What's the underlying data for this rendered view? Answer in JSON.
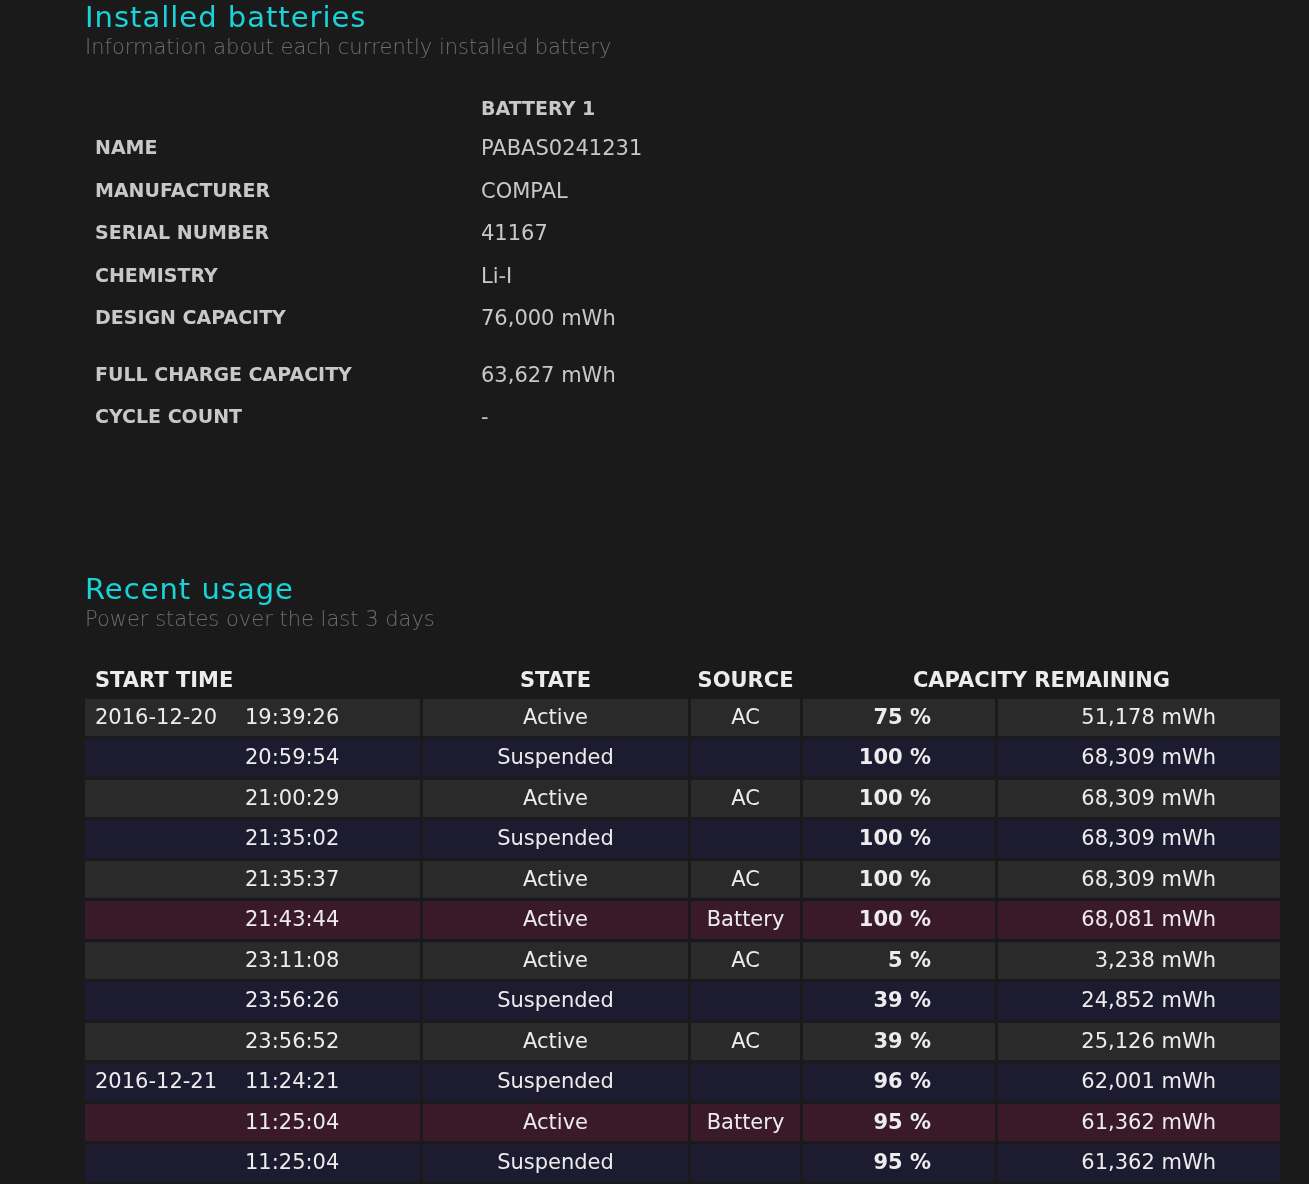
{
  "installed": {
    "title": "Installed batteries",
    "subtitle": "Information about each currently installed battery",
    "column_header": "BATTERY 1",
    "fields": [
      {
        "label": "NAME",
        "value": "PABAS0241231"
      },
      {
        "label": "MANUFACTURER",
        "value": "COMPAL"
      },
      {
        "label": "SERIAL NUMBER",
        "value": "41167"
      },
      {
        "label": "CHEMISTRY",
        "value": "Li-I"
      },
      {
        "label": "DESIGN CAPACITY",
        "value": "76,000 mWh"
      },
      {
        "label": "FULL CHARGE CAPACITY",
        "value": "63,627 mWh"
      },
      {
        "label": "CYCLE COUNT",
        "value": "-"
      }
    ]
  },
  "recent_usage": {
    "title": "Recent usage",
    "subtitle": "Power states over the last 3 days",
    "columns": [
      "START TIME",
      "STATE",
      "SOURCE",
      "CAPACITY REMAINING"
    ],
    "rows": [
      {
        "kind": "ac",
        "date": "2016-12-20",
        "time": "19:39:26",
        "state": "Active",
        "source": "AC",
        "percent": "75 %",
        "capacity": "51,178 mWh"
      },
      {
        "kind": "suspended",
        "time": "20:59:54",
        "state": "Suspended",
        "percent": "100 %",
        "capacity": "68,309 mWh"
      },
      {
        "kind": "ac",
        "time": "21:00:29",
        "state": "Active",
        "source": "AC",
        "percent": "100 %",
        "capacity": "68,309 mWh"
      },
      {
        "kind": "suspended",
        "time": "21:35:02",
        "state": "Suspended",
        "percent": "100 %",
        "capacity": "68,309 mWh"
      },
      {
        "kind": "ac",
        "time": "21:35:37",
        "state": "Active",
        "source": "AC",
        "percent": "100 %",
        "capacity": "68,309 mWh"
      },
      {
        "kind": "battery",
        "time": "21:43:44",
        "state": "Active",
        "source": "Battery",
        "percent": "100 %",
        "capacity": "68,081 mWh"
      },
      {
        "kind": "ac",
        "time": "23:11:08",
        "state": "Active",
        "source": "AC",
        "percent": "5 %",
        "capacity": "3,238 mWh"
      },
      {
        "kind": "suspended",
        "time": "23:56:26",
        "state": "Suspended",
        "percent": "39 %",
        "capacity": "24,852 mWh"
      },
      {
        "kind": "ac",
        "time": "23:56:52",
        "state": "Active",
        "source": "AC",
        "percent": "39 %",
        "capacity": "25,126 mWh"
      },
      {
        "kind": "suspended",
        "date": "2016-12-21",
        "time": "11:24:21",
        "state": "Suspended",
        "percent": "96 %",
        "capacity": "62,001 mWh"
      },
      {
        "kind": "battery",
        "time": "11:25:04",
        "state": "Active",
        "source": "Battery",
        "percent": "95 %",
        "capacity": "61,362 mWh"
      },
      {
        "kind": "suspended",
        "time": "11:25:04",
        "state": "Suspended",
        "percent": "95 %",
        "capacity": "61,362 mWh"
      }
    ]
  }
}
